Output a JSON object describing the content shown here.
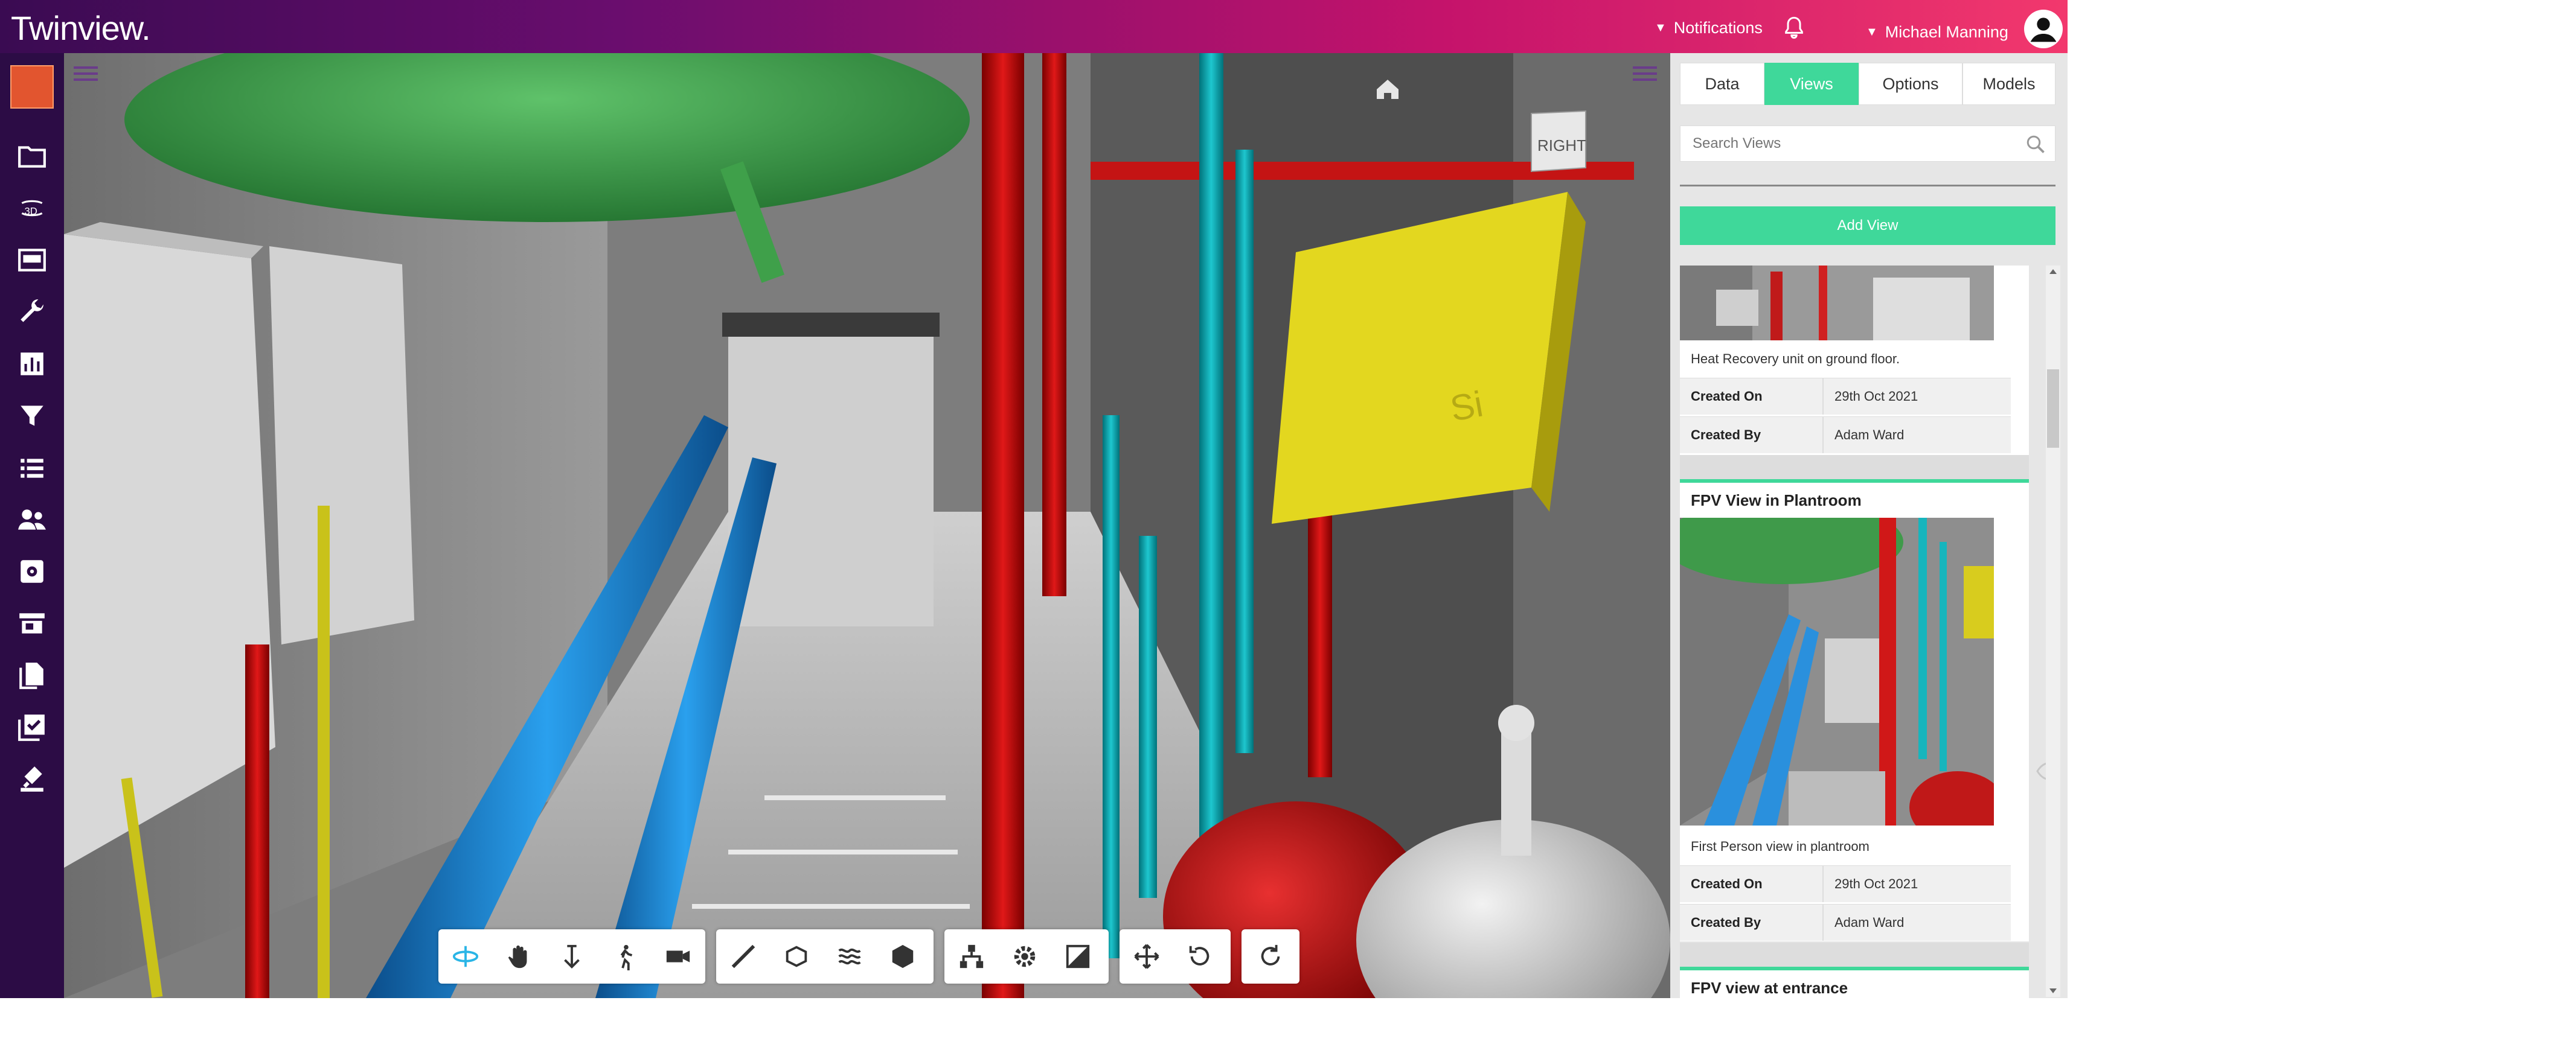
{
  "app": {
    "logo_text": "Twinview",
    "logo_mark": "."
  },
  "topbar": {
    "notifications_label": "Notifications",
    "user_name": "Michael Manning"
  },
  "sidebar": {
    "items": [
      {
        "icon": "project-logo-icon"
      },
      {
        "icon": "folder-icon"
      },
      {
        "icon": "3d-view-icon",
        "label": "3D"
      },
      {
        "icon": "dashboard-icon"
      },
      {
        "icon": "wrench-icon"
      },
      {
        "icon": "chart-icon"
      },
      {
        "icon": "filter-icon"
      },
      {
        "icon": "list-icon"
      },
      {
        "icon": "people-icon"
      },
      {
        "icon": "settings-icon"
      },
      {
        "icon": "store-icon"
      },
      {
        "icon": "documents-icon"
      },
      {
        "icon": "checklist-icon"
      },
      {
        "icon": "stamp-icon"
      }
    ]
  },
  "viewport": {
    "viewcube_face": "RIGHT",
    "home_icon": "home-icon"
  },
  "panel": {
    "tabs": [
      {
        "label": "Data",
        "active": false
      },
      {
        "label": "Views",
        "active": true
      },
      {
        "label": "Options",
        "active": false
      },
      {
        "label": "Models",
        "active": false
      }
    ],
    "search_placeholder": "Search Views",
    "add_view_label": "Add View",
    "views": [
      {
        "title": "",
        "description": "Heat Recovery unit on ground floor.",
        "created_on_label": "Created On",
        "created_on": "29th Oct 2021",
        "created_by_label": "Created By",
        "created_by": "Adam Ward"
      },
      {
        "title": "FPV View in Plantroom",
        "description": "First Person view in plantroom",
        "created_on_label": "Created On",
        "created_on": "29th Oct 2021",
        "created_by_label": "Created By",
        "created_by": "Adam Ward"
      },
      {
        "title": "FPV view at entrance"
      }
    ]
  },
  "toolbar": {
    "groups": [
      [
        "orbit-icon",
        "pan-icon",
        "dolly-icon",
        "walk-icon",
        "camera-icon"
      ],
      [
        "measure-icon",
        "section-icon",
        "explode-icon",
        "cube-icon"
      ],
      [
        "model-browser-icon",
        "settings-icon",
        "properties-icon"
      ],
      [
        "move-icon",
        "rotate-icon"
      ],
      [
        "reset-icon"
      ]
    ]
  },
  "colors": {
    "accent": "#3fd89a",
    "sidebar": "#2c0c45",
    "topbar_start": "#3a0b52",
    "topbar_end": "#f2386d"
  }
}
